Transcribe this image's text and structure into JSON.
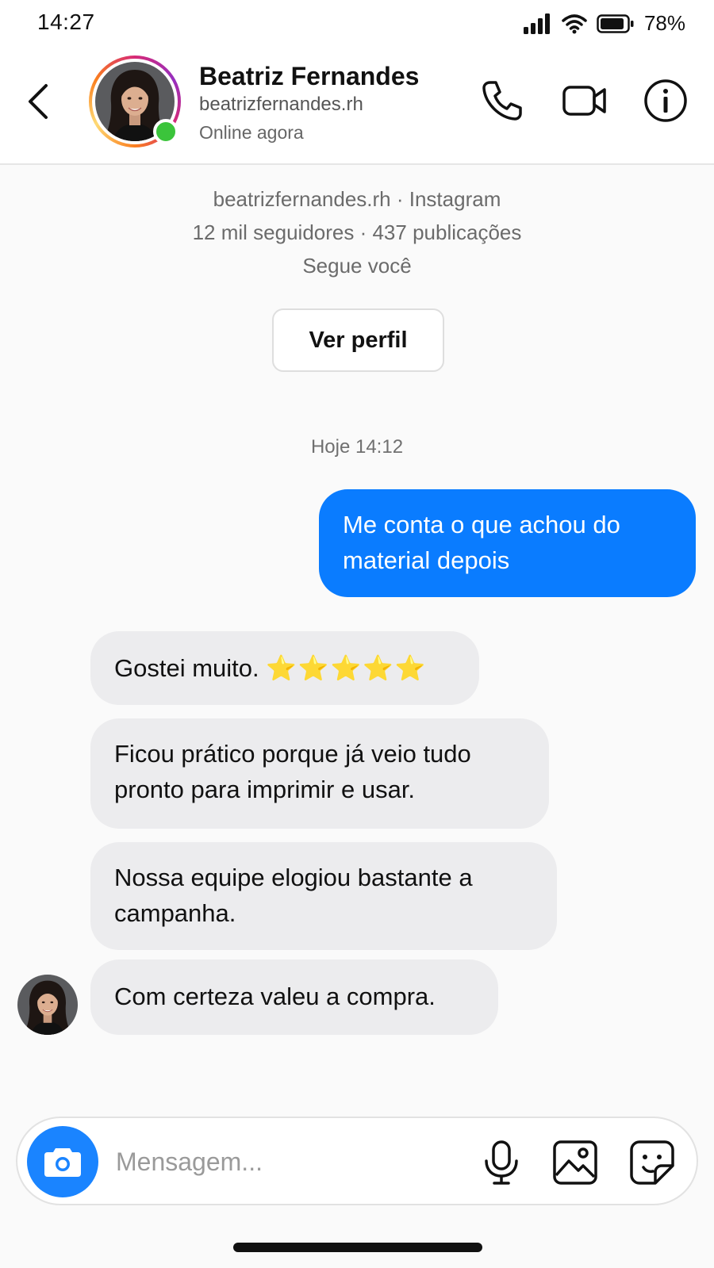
{
  "status_bar": {
    "time": "14:27",
    "battery_percent": "78%",
    "icons": [
      "signal-icon",
      "wifi-icon",
      "battery-icon"
    ]
  },
  "header": {
    "name": "Beatriz Fernandes",
    "username": "beatrizfernandes.rh",
    "status": "Online agora",
    "icons": [
      "back-icon",
      "phone-icon",
      "video-camera-icon",
      "info-icon"
    ],
    "online_color": "#3bc43b"
  },
  "profile_summary": {
    "line1": "beatrizfernandes.rh · Instagram",
    "line2": "12 mil seguidores · 437 publicações",
    "line3": "Segue você",
    "view_profile_label": "Ver perfil"
  },
  "conversation": {
    "timestamp": "Hoje 14:12",
    "outgoing": [
      {
        "text": "Me conta o que achou do material depois"
      }
    ],
    "incoming": [
      {
        "text": "Gostei muito.",
        "stars": "⭐⭐⭐⭐⭐"
      },
      {
        "text": "Ficou prático porque já veio tudo pronto para imprimir e usar."
      },
      {
        "text": "Nossa equipe elogiou bastante a campanha."
      },
      {
        "text": "Com certeza valeu a compra."
      }
    ],
    "outgoing_color": "#0a7cff",
    "incoming_color": "#ececee"
  },
  "composer": {
    "placeholder": "Mensagem...",
    "value": "",
    "icons": [
      "camera-icon",
      "microphone-icon",
      "gallery-icon",
      "sticker-icon"
    ],
    "camera_color": "#1a84ff"
  }
}
